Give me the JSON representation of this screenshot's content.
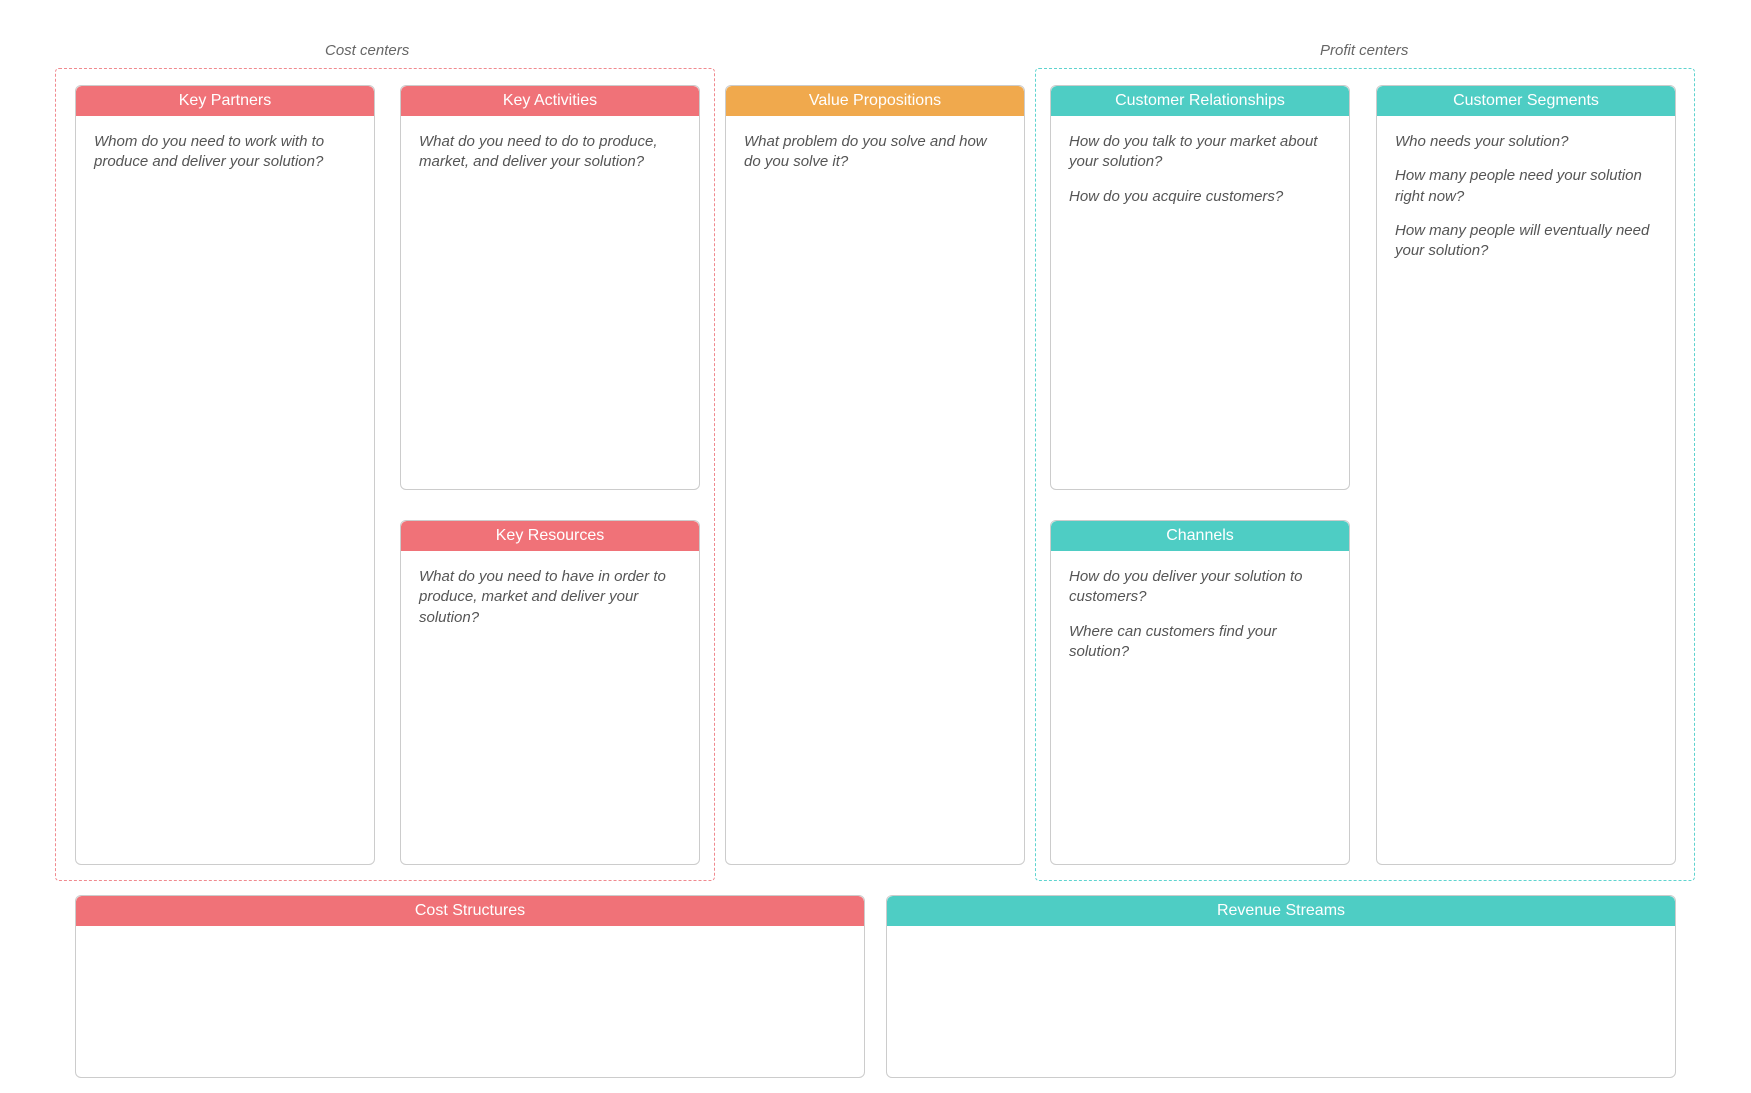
{
  "groups": {
    "cost_centers_label": "Cost centers",
    "profit_centers_label": "Profit centers"
  },
  "cards": {
    "key_partners": {
      "title": "Key Partners",
      "q1": "Whom do you need to work with to produce and deliver your solution?"
    },
    "key_activities": {
      "title": "Key Activities",
      "q1": "What do you need to do to produce, market, and deliver your solution?"
    },
    "key_resources": {
      "title": "Key Resources",
      "q1": "What do you need to have in order to produce, market and deliver your solution?"
    },
    "value_propositions": {
      "title": "Value Propositions",
      "q1": "What problem do you solve and how do you solve it?"
    },
    "customer_relationships": {
      "title": "Customer Relationships",
      "q1": "How do you talk to your market about your solution?",
      "q2": "How do you acquire customers?"
    },
    "channels": {
      "title": "Channels",
      "q1": "How do you deliver your solution to customers?",
      "q2": "Where can customers find your solution?"
    },
    "customer_segments": {
      "title": "Customer Segments",
      "q1": "Who needs your solution?",
      "q2": "How many people need your solution right now?",
      "q3": "How many people will eventually need your solution?"
    },
    "cost_structures": {
      "title": "Cost Structures"
    },
    "revenue_streams": {
      "title": "Revenue Streams"
    }
  }
}
